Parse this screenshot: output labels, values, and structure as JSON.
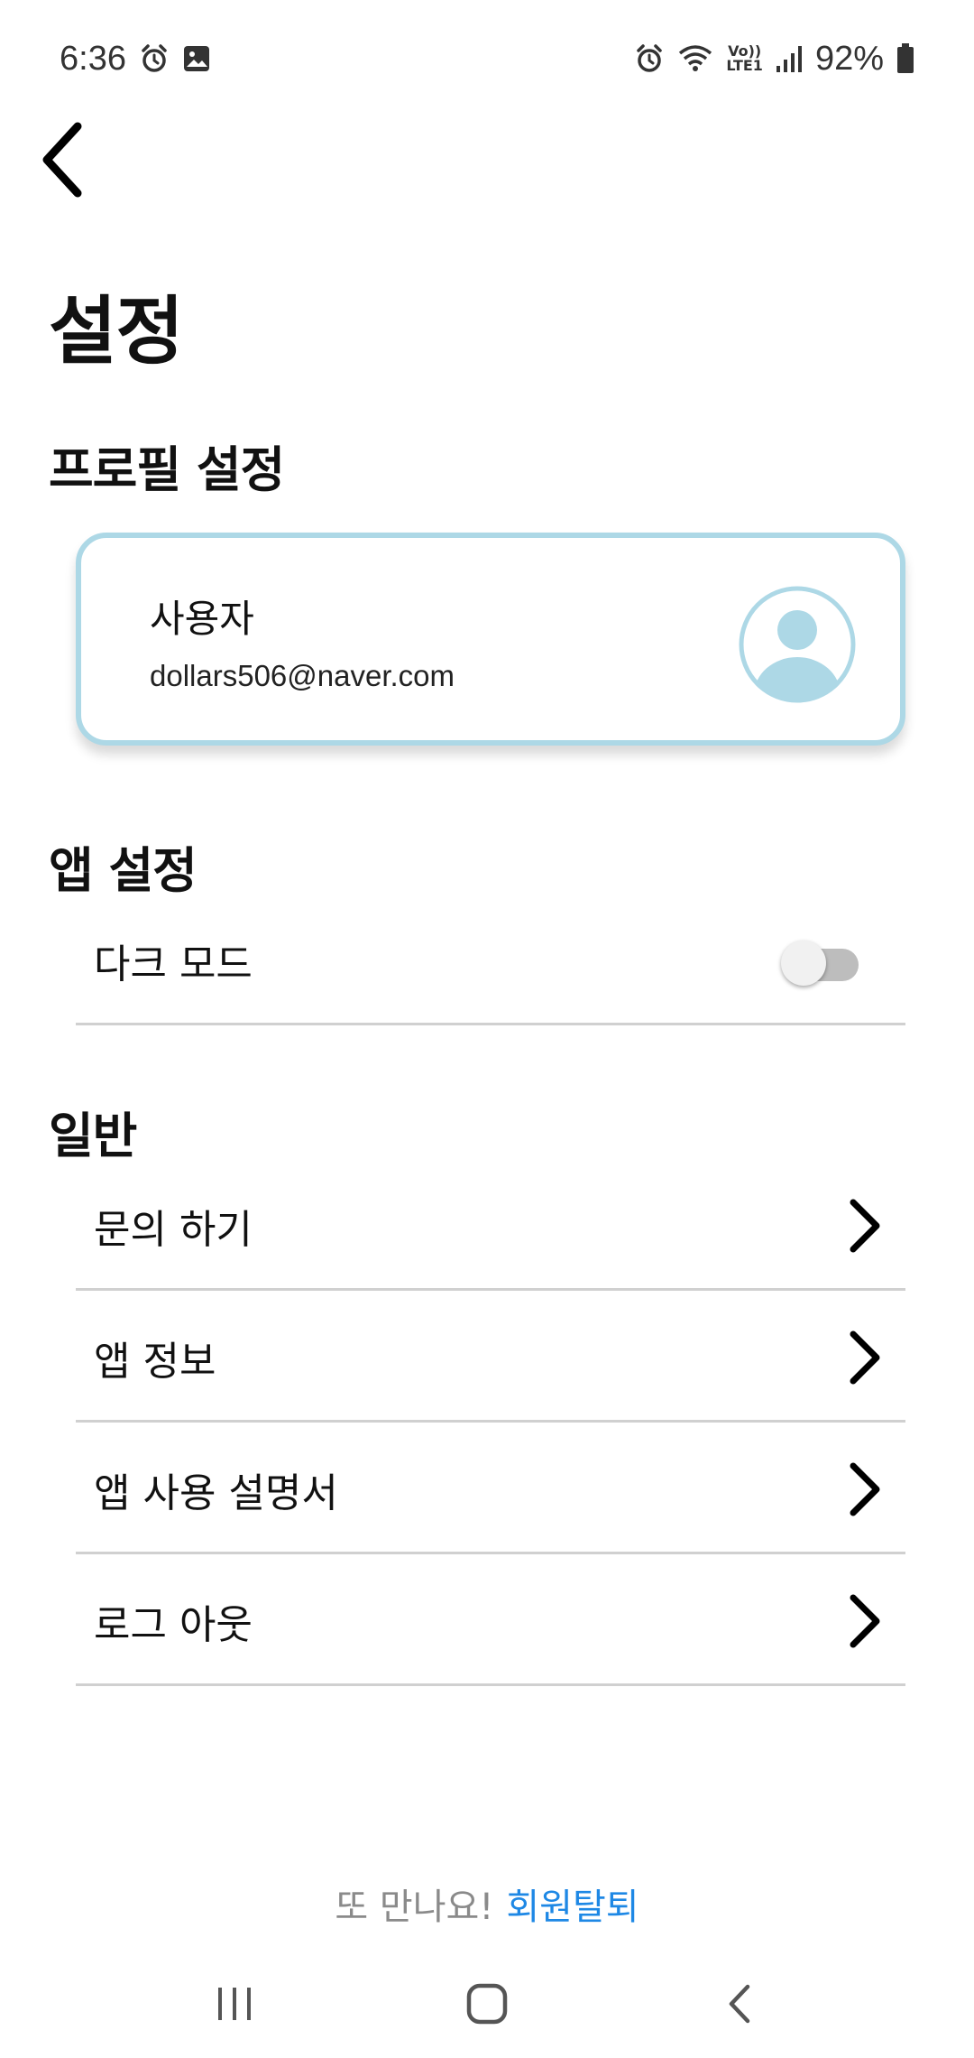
{
  "status_bar": {
    "time": "6:36",
    "battery": "92%",
    "network": "LTE1",
    "volte": "Vo))"
  },
  "header": {
    "back_icon": "chevron-left-icon",
    "title": "설정"
  },
  "profile_section": {
    "title": "프로필 설정",
    "name": "사용자",
    "email": "dollars506@naver.com",
    "avatar_icon": "user-avatar-icon",
    "accent_color": "#add8e6"
  },
  "app_section": {
    "title": "앱 설정",
    "dark_mode_label": "다크 모드",
    "dark_mode_on": false
  },
  "general_section": {
    "title": "일반",
    "items": [
      {
        "label": "문의 하기",
        "icon": "chevron-right-icon"
      },
      {
        "label": "앱 정보",
        "icon": "chevron-right-icon"
      },
      {
        "label": "앱 사용 설명서",
        "icon": "chevron-right-icon"
      },
      {
        "label": "로그 아웃",
        "icon": "chevron-right-icon"
      }
    ]
  },
  "footer": {
    "text": "또 만나요!",
    "withdraw_link": "회원탈퇴",
    "link_color": "#1e88e5"
  }
}
